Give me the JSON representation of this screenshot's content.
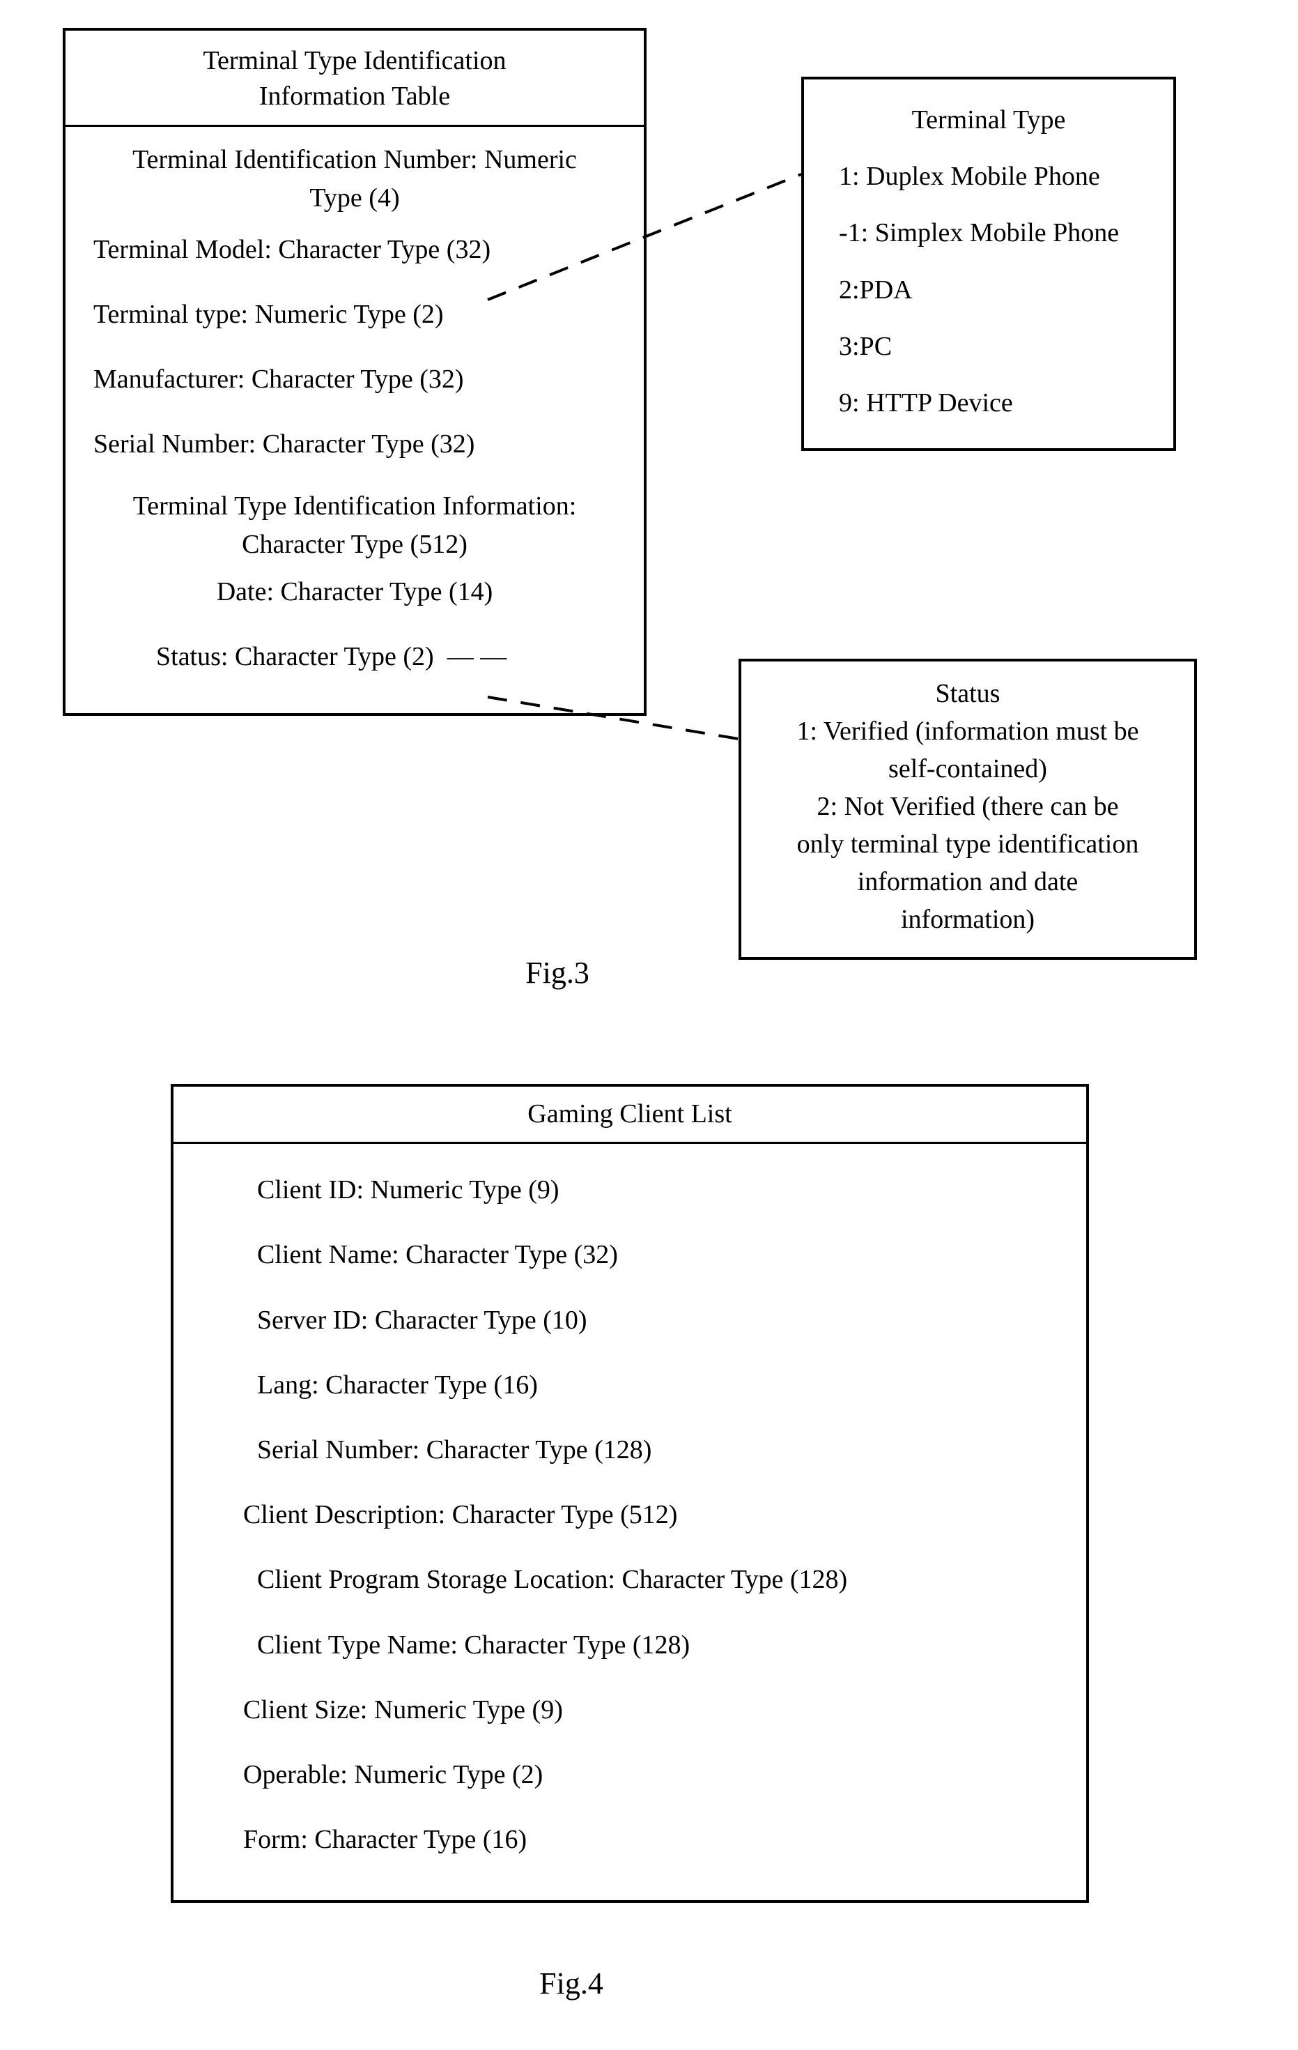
{
  "fig3": {
    "main": {
      "title_line1": "Terminal Type Identification",
      "title_line2": "Information Table",
      "rows": {
        "r1a": "Terminal Identification Number: Numeric",
        "r1b": "Type (4)",
        "r2": "Terminal Model: Character Type (32)",
        "r3": "Terminal type: Numeric Type (2)",
        "r4": "Manufacturer: Character Type (32)",
        "r5": "Serial Number: Character Type (32)",
        "r6a": "Terminal Type Identification Information:",
        "r6b": "Character Type (512)",
        "r7": "Date: Character Type (14)",
        "r8": "Status: Character Type (2)"
      }
    },
    "terminalType": {
      "title": "Terminal Type",
      "items": {
        "i1": "1: Duplex Mobile Phone",
        "i2": "-1: Simplex Mobile Phone",
        "i3": "2:PDA",
        "i4": "3:PC",
        "i5": "9: HTTP Device"
      }
    },
    "status": {
      "title": "Status",
      "l1": "1: Verified (information must be",
      "l2": "self-contained)",
      "l3": "2: Not Verified (there can be",
      "l4": "only terminal type identification",
      "l5": "information and date",
      "l6": "information)"
    },
    "label": "Fig.3"
  },
  "fig4": {
    "title": "Gaming Client List",
    "rows": {
      "r1": "Client ID: Numeric Type (9)",
      "r2": "Client Name: Character Type (32)",
      "r3": "Server ID: Character Type (10)",
      "r4": "Lang: Character Type (16)",
      "r5": "Serial Number: Character Type (128)",
      "r6": "Client Description: Character Type (512)",
      "r7": "Client Program Storage Location: Character Type (128)",
      "r8": "Client Type Name: Character Type (128)",
      "r9": "Client Size: Numeric Type (9)",
      "r10": "Operable: Numeric Type (2)",
      "r11": "Form: Character Type (16)"
    },
    "label": "Fig.4"
  }
}
